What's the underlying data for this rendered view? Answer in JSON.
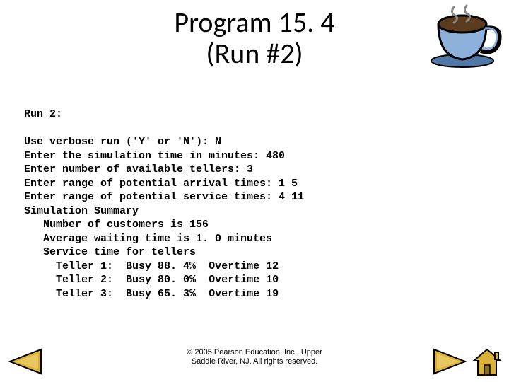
{
  "title_line1": "Program 15. 4",
  "title_line2": "(Run #2)",
  "run_label": "Run 2:",
  "lines": {
    "l1": "Use verbose run ('Y' or 'N'): N",
    "l2": "Enter the simulation time in minutes: 480",
    "l3": "Enter number of available tellers: 3",
    "l4": "Enter range of potential arrival times: 1 5",
    "l5": "Enter range of potential service times: 4 11",
    "l6": "Simulation Summary",
    "l7": "   Number of customers is 156",
    "l8": "   Average waiting time is 1. 0 minutes",
    "l9": "   Service time for tellers"
  },
  "tellers": [
    {
      "name": "Teller 1:",
      "busy": "Busy 88. 4%",
      "over": "Overtime 12"
    },
    {
      "name": "Teller 2:",
      "busy": "Busy 80. 0%",
      "over": "Overtime 10"
    },
    {
      "name": "Teller 3:",
      "busy": "Busy 65. 3%",
      "over": "Overtime 19"
    }
  ],
  "copyright_l1": "© 2005 Pearson Education, Inc., Upper",
  "copyright_l2": "Saddle River, NJ.  All rights reserved."
}
